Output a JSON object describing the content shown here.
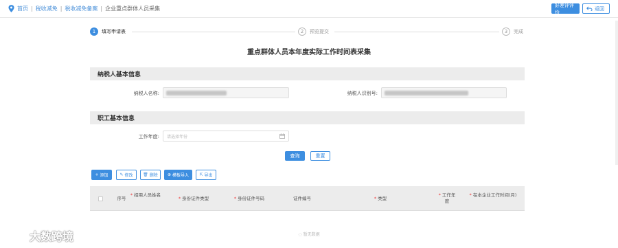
{
  "breadcrumb": {
    "home": "首页",
    "level1": "税收减免",
    "level2": "税收减免备案",
    "current": "企业重点群体人员采集"
  },
  "header": {
    "evaluate_label": "好差评评价",
    "back_label": "返回"
  },
  "steps": [
    {
      "num": "1",
      "label": "填写申请表"
    },
    {
      "num": "2",
      "label": "预览提交"
    },
    {
      "num": "3",
      "label": "完成"
    }
  ],
  "form_title": "重点群体人员本年度实际工作时间表采集",
  "taxpayer_section": {
    "title": "纳税人基本信息",
    "name_label": "纳税人名称:",
    "id_label": "纳税人识别号:"
  },
  "employee_section": {
    "title": "职工基本信息",
    "year_label": "工作年度:",
    "year_placeholder": "请选择年份"
  },
  "actions": {
    "query": "查询",
    "reset": "重置"
  },
  "toolbar": {
    "add": "添加",
    "edit": "修改",
    "delete": "删除",
    "template_import": "模板导入",
    "export": "导出"
  },
  "table": {
    "columns": [
      "序号",
      "招用人员姓名",
      "身份证件类型",
      "身份证件号码",
      "证件编号",
      "类型",
      "工作年度",
      "在本企业工作时间(月)"
    ],
    "required": [
      false,
      true,
      true,
      true,
      false,
      true,
      true,
      true
    ],
    "empty_text": "暂无数据"
  },
  "watermark": "大数跨境",
  "colors": {
    "accent": "#3d8ee0",
    "section_bg": "#ececec",
    "required": "#e33333"
  }
}
